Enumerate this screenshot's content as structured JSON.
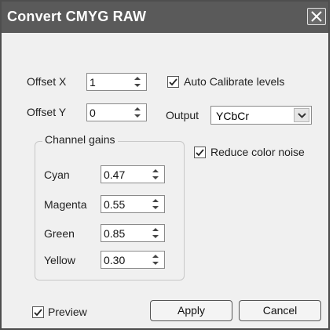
{
  "dialog": {
    "title": "Convert CMYG RAW"
  },
  "offset": {
    "x_label": "Offset X",
    "x_value": "1",
    "y_label": "Offset Y",
    "y_value": "0"
  },
  "auto_calibrate": {
    "label": "Auto Calibrate levels",
    "checked": true
  },
  "output": {
    "label": "Output",
    "selected": "YCbCr"
  },
  "reduce_noise": {
    "label": "Reduce color noise",
    "checked": true
  },
  "channel_gains": {
    "title": "Channel gains",
    "items": [
      {
        "label": "Cyan",
        "value": "0.47"
      },
      {
        "label": "Magenta",
        "value": "0.55"
      },
      {
        "label": "Green",
        "value": "0.85"
      },
      {
        "label": "Yellow",
        "value": "0.30"
      }
    ]
  },
  "preview": {
    "label": "Preview",
    "checked": true
  },
  "buttons": {
    "apply": "Apply",
    "cancel": "Cancel"
  }
}
